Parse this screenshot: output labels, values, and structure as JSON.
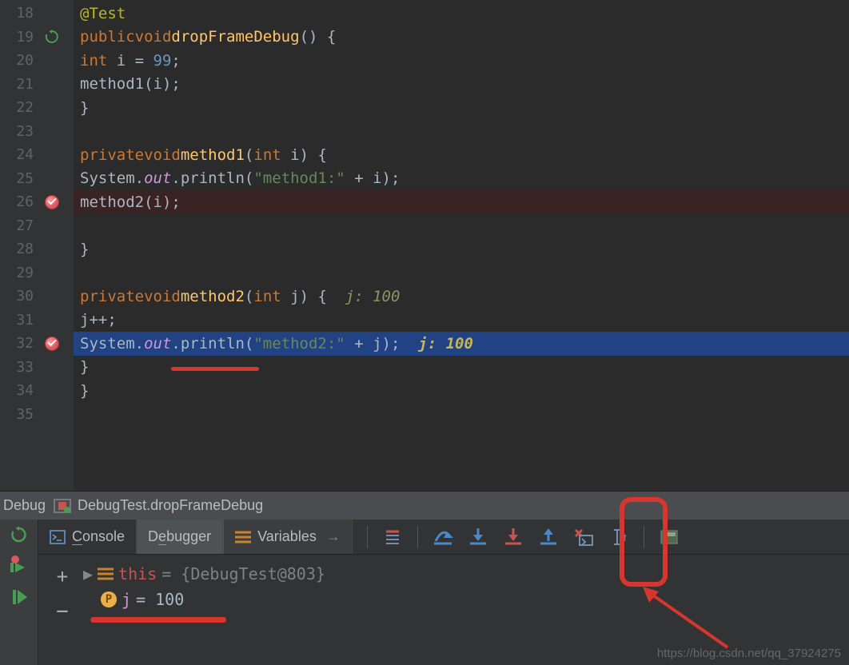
{
  "gutter": {
    "lines": [
      18,
      19,
      20,
      21,
      22,
      23,
      24,
      25,
      26,
      27,
      28,
      29,
      30,
      31,
      32,
      33,
      34,
      35
    ]
  },
  "code": {
    "l18_ann": "@Test",
    "l19_kw1": "public",
    "l19_kw2": "void",
    "l19_fn": "dropFrameDebug",
    "l19_tail": "() {",
    "l20_kw": "int",
    "l20_rest": " i = ",
    "l20_num": "99",
    "l20_semi": ";",
    "l21": "method1(i);",
    "l22": "}",
    "l24_kw1": "private",
    "l24_kw2": "void",
    "l24_fn": "method1",
    "l24_p1": "(",
    "l24_kw3": "int",
    "l24_p2": " i) {",
    "l25_a": "System.",
    "l25_out": "out",
    "l25_b": ".println(",
    "l25_str": "\"method1:\"",
    "l25_c": " + i);",
    "l26": "method2(i);",
    "l28": "}",
    "l30_kw1": "private",
    "l30_kw2": "void",
    "l30_fn": "method2",
    "l30_p1": "(",
    "l30_kw3": "int",
    "l30_p2": " j) {  ",
    "l30_inlay": "j: 100",
    "l31": "j++;",
    "l32_a": "System.",
    "l32_out": "out",
    "l32_b": ".println(",
    "l32_str": "\"method2:\"",
    "l32_c": " + j);  ",
    "l32_inlay": "j: 100",
    "l33": "}",
    "l34": "}"
  },
  "debugBar": {
    "title": "Debug",
    "frame": "DebugTest.dropFrameDebug"
  },
  "tabs": {
    "console": "Console",
    "debugger": "Debugger",
    "variables": "Variables"
  },
  "vars": {
    "this_label": "this",
    "this_val": " = {DebugTest@803}",
    "j_label": "j",
    "j_val": " = 100"
  },
  "watermark": "https://blog.csdn.net/qq_37924275"
}
